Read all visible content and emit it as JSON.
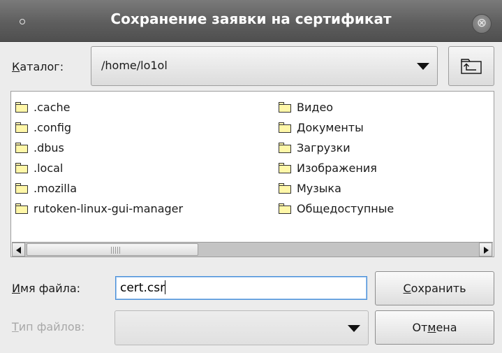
{
  "window": {
    "title": "Сохранение заявки на сертификат",
    "close_glyph": "⊗"
  },
  "folder_bar": {
    "label_accel": "К",
    "label_rest": "аталог:",
    "path": "/home/lo1ol"
  },
  "files": {
    "left": [
      ".cache",
      ".config",
      ".dbus",
      ".local",
      ".mozilla",
      "rutoken-linux-gui-manager"
    ],
    "right": [
      "Видео",
      "Документы",
      "Загрузки",
      "Изображения",
      "Музыка",
      "Общедоступные"
    ],
    "horizontal_scroll_fraction": 0.38
  },
  "filename": {
    "label_accel": "И",
    "label_rest": "мя файла:",
    "value": "cert.csr"
  },
  "filetype": {
    "label_accel": "Т",
    "label_rest": "ип файлов:",
    "value": ""
  },
  "buttons": {
    "save_accel": "С",
    "save_rest": "охранить",
    "cancel_pre": "От",
    "cancel_accel": "м",
    "cancel_post": "ена"
  },
  "icons": {
    "folder": "folder-icon",
    "parent_dir": "folder-up-icon",
    "close": "close-icon"
  },
  "colors": {
    "titlebar": "#5e5e5e",
    "folder_fill": "#fff7a8",
    "focus_border": "#4a90d9"
  }
}
